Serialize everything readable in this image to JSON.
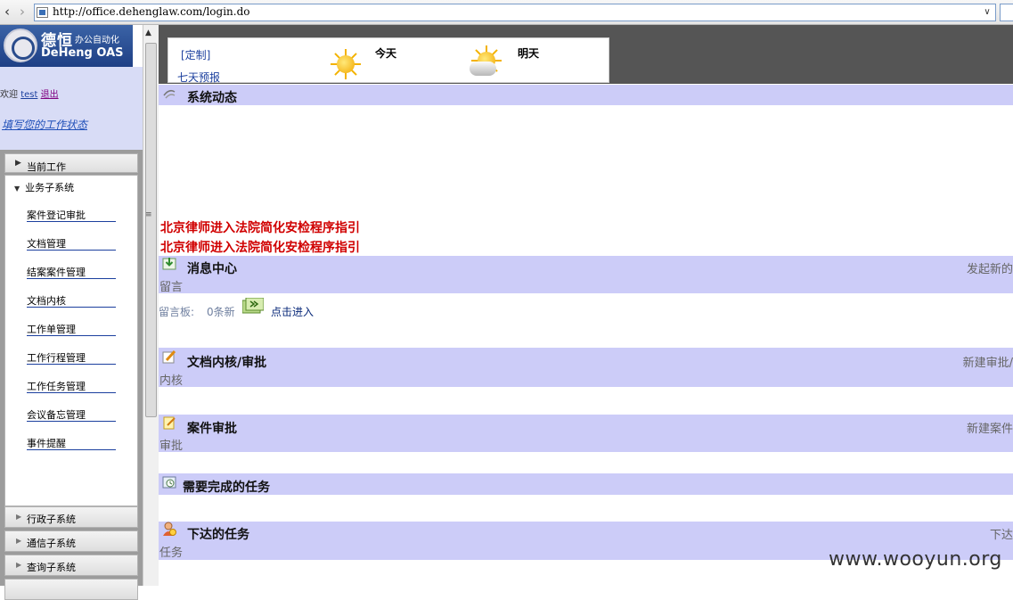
{
  "browser": {
    "url": "http://office.dehenglaw.com/login.do"
  },
  "left": {
    "logo_cn": "德恒",
    "logo_cn_small": "办公自动化",
    "logo_en": "DeHeng OAS",
    "welcome_prefix": "欢迎",
    "username": "test",
    "logout": "退出",
    "status_link": "填写您的工作状态",
    "menu_current": "当前工作",
    "menu_business": "业务子系统",
    "sub_items": [
      "案件登记审批",
      "文档管理",
      "结案案件管理",
      "文档内核",
      "工作单管理",
      "工作行程管理",
      "工作任务管理",
      "会议备忘管理",
      "事件提醒"
    ],
    "footer_items": [
      "行政子系统",
      "通信子系统",
      "查询子系统"
    ]
  },
  "weather": {
    "custom": "[定制]",
    "seven_day": "七天预报",
    "today": "今天",
    "tomorrow": "明天"
  },
  "sections": {
    "system": {
      "title": "系统动态"
    },
    "news": [
      "北京律师进入法院简化安检程序指引",
      "北京律师进入法院简化安检程序指引"
    ],
    "message": {
      "title": "消息中心",
      "right": "发起新的",
      "sub": "留言"
    },
    "board": {
      "label": "留言板:",
      "count": "0条新",
      "enter": "点击进入"
    },
    "doc": {
      "title": "文档内核/审批",
      "right": "新建审批/",
      "sub": "内核"
    },
    "case": {
      "title": "案件审批",
      "right": "新建案件",
      "sub": "审批"
    },
    "todo": {
      "title": "需要完成的任务"
    },
    "assigned": {
      "title": "下达的任务",
      "right": "下达",
      "sub": "任务"
    }
  },
  "watermark": "www.wooyun.org"
}
